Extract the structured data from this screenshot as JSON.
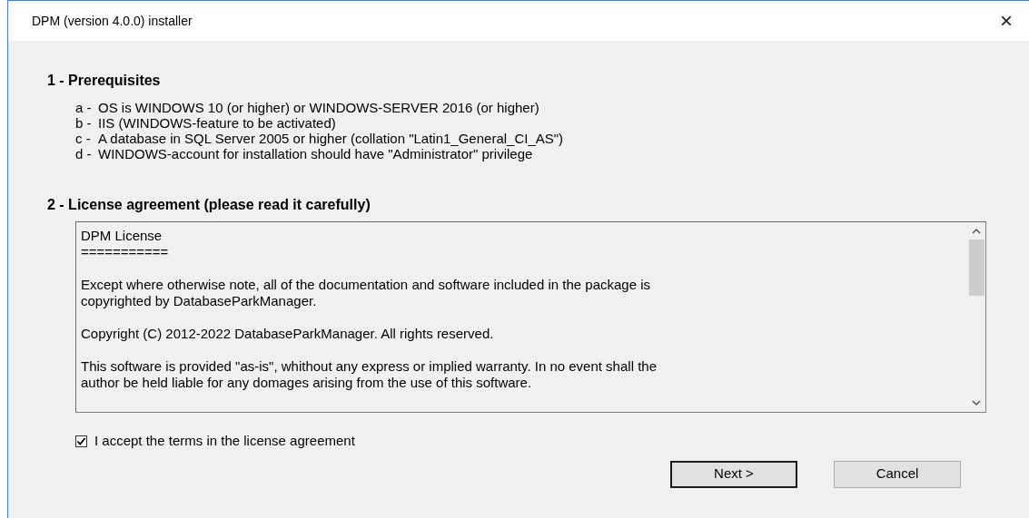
{
  "window": {
    "title": "DPM (version 4.0.0) installer",
    "close": "×"
  },
  "prerequisites": {
    "heading": "1  -  Prerequisites",
    "items": [
      {
        "marker": "a -",
        "text": "OS is WINDOWS 10 (or higher) or WINDOWS-SERVER 2016 (or higher)"
      },
      {
        "marker": "b -",
        "text": "IIS (WINDOWS-feature to be activated)"
      },
      {
        "marker": "c -",
        "text": "A database in SQL Server 2005 or higher (collation \"Latin1_General_CI_AS\")"
      },
      {
        "marker": "d -",
        "text": "WINDOWS-account for installation should have \"Administrator\" privilege"
      }
    ]
  },
  "license": {
    "heading": "2  -  License agreement (please read it carefully)",
    "paragraphs": [
      {
        "lines": [
          "DPM License",
          "==========="
        ]
      },
      {
        "lines": [
          "Except where otherwise note, all of the documentation and software included in the package is",
          "copyrighted by DatabaseParkManager."
        ]
      },
      {
        "lines": [
          "Copyright (C) 2012-2022 DatabaseParkManager. All rights reserved."
        ]
      },
      {
        "lines": [
          "This software is provided \"as-is\", whithout any express or implied warranty. In no event shall the",
          "author be held liable for any domages arising from the use of this software."
        ]
      }
    ]
  },
  "accept": {
    "label": "I accept the terms in the license agreement",
    "checked": true
  },
  "buttons": [
    {
      "label": "Next >",
      "default": true
    },
    {
      "label": "Cancel",
      "default": false
    }
  ]
}
